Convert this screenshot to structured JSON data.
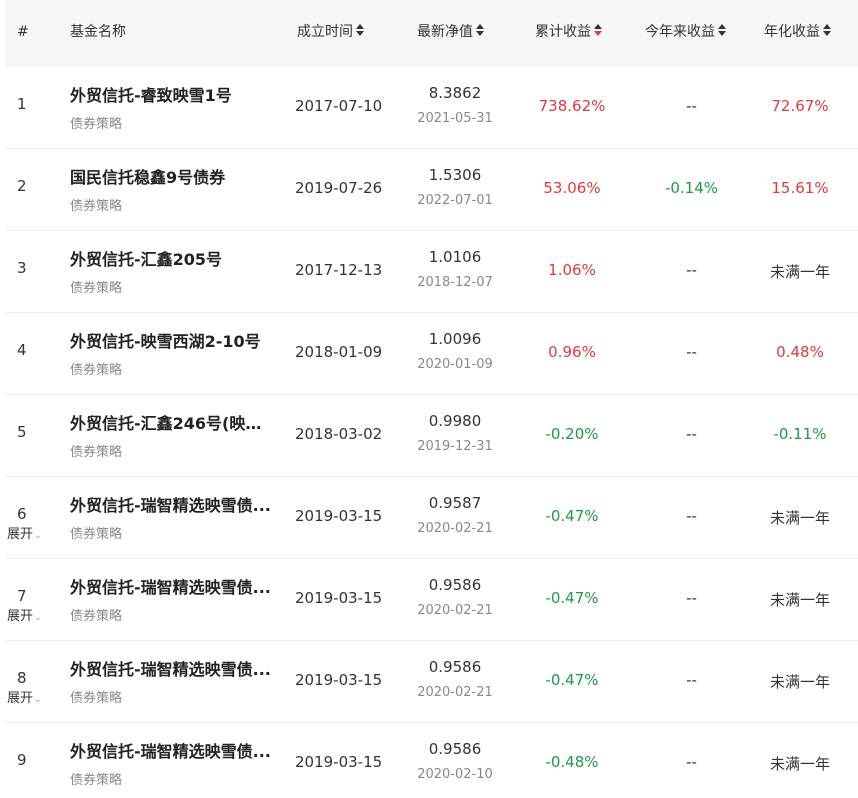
{
  "header": {
    "index": "#",
    "name": "基金名称",
    "inception": "成立时间",
    "nav": "最新净值",
    "cumulative": "累计收益",
    "ytd": "今年来收益",
    "annualized": "年化收益"
  },
  "colors": {
    "up": "#e3383c",
    "down": "#1a9c46"
  },
  "rows": [
    {
      "index": "1",
      "name": "外贸信托-睿致映雪1号",
      "strategy": "债券策略",
      "inception": "2017-07-10",
      "nav": "8.3862",
      "nav_date": "2021-05-31",
      "cumulative": "738.62%",
      "cum_class": "red",
      "ytd": "--",
      "ytd_class": "plain",
      "annualized": "72.67%",
      "ann_class": "red",
      "expand": ""
    },
    {
      "index": "2",
      "name": "国民信托稳鑫9号债券",
      "strategy": "债券策略",
      "inception": "2019-07-26",
      "nav": "1.5306",
      "nav_date": "2022-07-01",
      "cumulative": "53.06%",
      "cum_class": "red",
      "ytd": "-0.14%",
      "ytd_class": "green",
      "annualized": "15.61%",
      "ann_class": "red",
      "expand": ""
    },
    {
      "index": "3",
      "name": "外贸信托-汇鑫205号",
      "strategy": "债券策略",
      "inception": "2017-12-13",
      "nav": "1.0106",
      "nav_date": "2018-12-07",
      "cumulative": "1.06%",
      "cum_class": "red",
      "ytd": "--",
      "ytd_class": "plain",
      "annualized": "未满一年",
      "ann_class": "plain",
      "expand": ""
    },
    {
      "index": "4",
      "name": "外贸信托-映雪西湖2-10号",
      "strategy": "债券策略",
      "inception": "2018-01-09",
      "nav": "1.0096",
      "nav_date": "2020-01-09",
      "cumulative": "0.96%",
      "cum_class": "red",
      "ytd": "--",
      "ytd_class": "plain",
      "annualized": "0.48%",
      "ann_class": "red",
      "expand": ""
    },
    {
      "index": "5",
      "name": "外贸信托-汇鑫246号(映雪...",
      "strategy": "债券策略",
      "inception": "2018-03-02",
      "nav": "0.9980",
      "nav_date": "2019-12-31",
      "cumulative": "-0.20%",
      "cum_class": "green",
      "ytd": "--",
      "ytd_class": "plain",
      "annualized": "-0.11%",
      "ann_class": "green",
      "expand": ""
    },
    {
      "index": "6",
      "name": "外贸信托-瑞智精选映雪债...",
      "strategy": "债券策略",
      "inception": "2019-03-15",
      "nav": "0.9587",
      "nav_date": "2020-02-21",
      "cumulative": "-0.47%",
      "cum_class": "green",
      "ytd": "--",
      "ytd_class": "plain",
      "annualized": "未满一年",
      "ann_class": "plain",
      "expand": "展开"
    },
    {
      "index": "7",
      "name": "外贸信托-瑞智精选映雪债...",
      "strategy": "债券策略",
      "inception": "2019-03-15",
      "nav": "0.9586",
      "nav_date": "2020-02-21",
      "cumulative": "-0.47%",
      "cum_class": "green",
      "ytd": "--",
      "ytd_class": "plain",
      "annualized": "未满一年",
      "ann_class": "plain",
      "expand": "展开"
    },
    {
      "index": "8",
      "name": "外贸信托-瑞智精选映雪债...",
      "strategy": "债券策略",
      "inception": "2019-03-15",
      "nav": "0.9586",
      "nav_date": "2020-02-21",
      "cumulative": "-0.47%",
      "cum_class": "green",
      "ytd": "--",
      "ytd_class": "plain",
      "annualized": "未满一年",
      "ann_class": "plain",
      "expand": "展开"
    },
    {
      "index": "9",
      "name": "外贸信托-瑞智精选映雪债...",
      "strategy": "债券策略",
      "inception": "2019-03-15",
      "nav": "0.9586",
      "nav_date": "2020-02-10",
      "cumulative": "-0.48%",
      "cum_class": "green",
      "ytd": "--",
      "ytd_class": "plain",
      "annualized": "未满一年",
      "ann_class": "plain",
      "expand": ""
    }
  ]
}
